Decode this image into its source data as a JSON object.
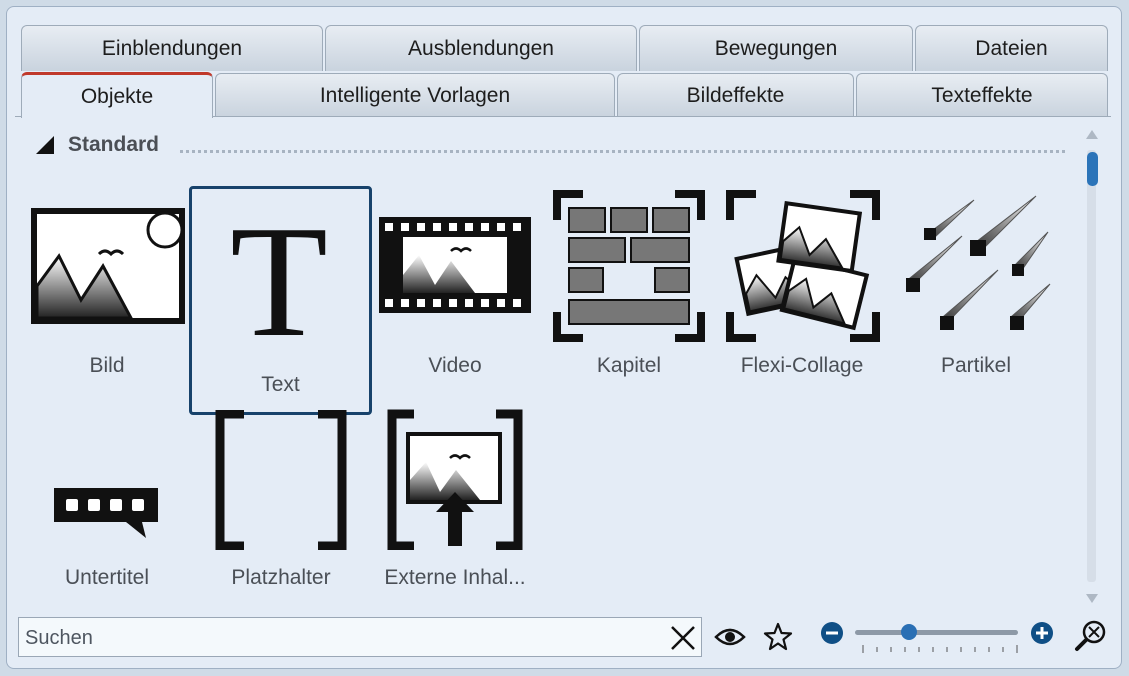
{
  "tabs_row1": [
    {
      "label": "Einblendungen"
    },
    {
      "label": "Ausblendungen"
    },
    {
      "label": "Bewegungen"
    },
    {
      "label": "Dateien"
    }
  ],
  "tabs_row2": [
    {
      "label": "Objekte",
      "active": true
    },
    {
      "label": "Intelligente Vorlagen"
    },
    {
      "label": "Bildeffekte"
    },
    {
      "label": "Texteffekte"
    }
  ],
  "section": {
    "title": "Standard"
  },
  "items": [
    {
      "label": "Bild",
      "icon": "image-icon"
    },
    {
      "label": "Text",
      "icon": "text-icon",
      "selected": true
    },
    {
      "label": "Video",
      "icon": "video-icon"
    },
    {
      "label": "Kapitel",
      "icon": "chapter-icon"
    },
    {
      "label": "Flexi-Collage",
      "icon": "collage-icon"
    },
    {
      "label": "Partikel",
      "icon": "particle-icon"
    },
    {
      "label": "Untertitel",
      "icon": "subtitle-icon"
    },
    {
      "label": "Platzhalter",
      "icon": "placeholder-icon"
    },
    {
      "label": "Externe Inhal...",
      "icon": "external-content-icon"
    }
  ],
  "search": {
    "placeholder": "Suchen",
    "value": ""
  },
  "colors": {
    "accent": "#2a6fb4",
    "active_tab_marker": "#c0392b",
    "selection_border": "#17426b"
  },
  "zoom": {
    "level": 0.33
  }
}
